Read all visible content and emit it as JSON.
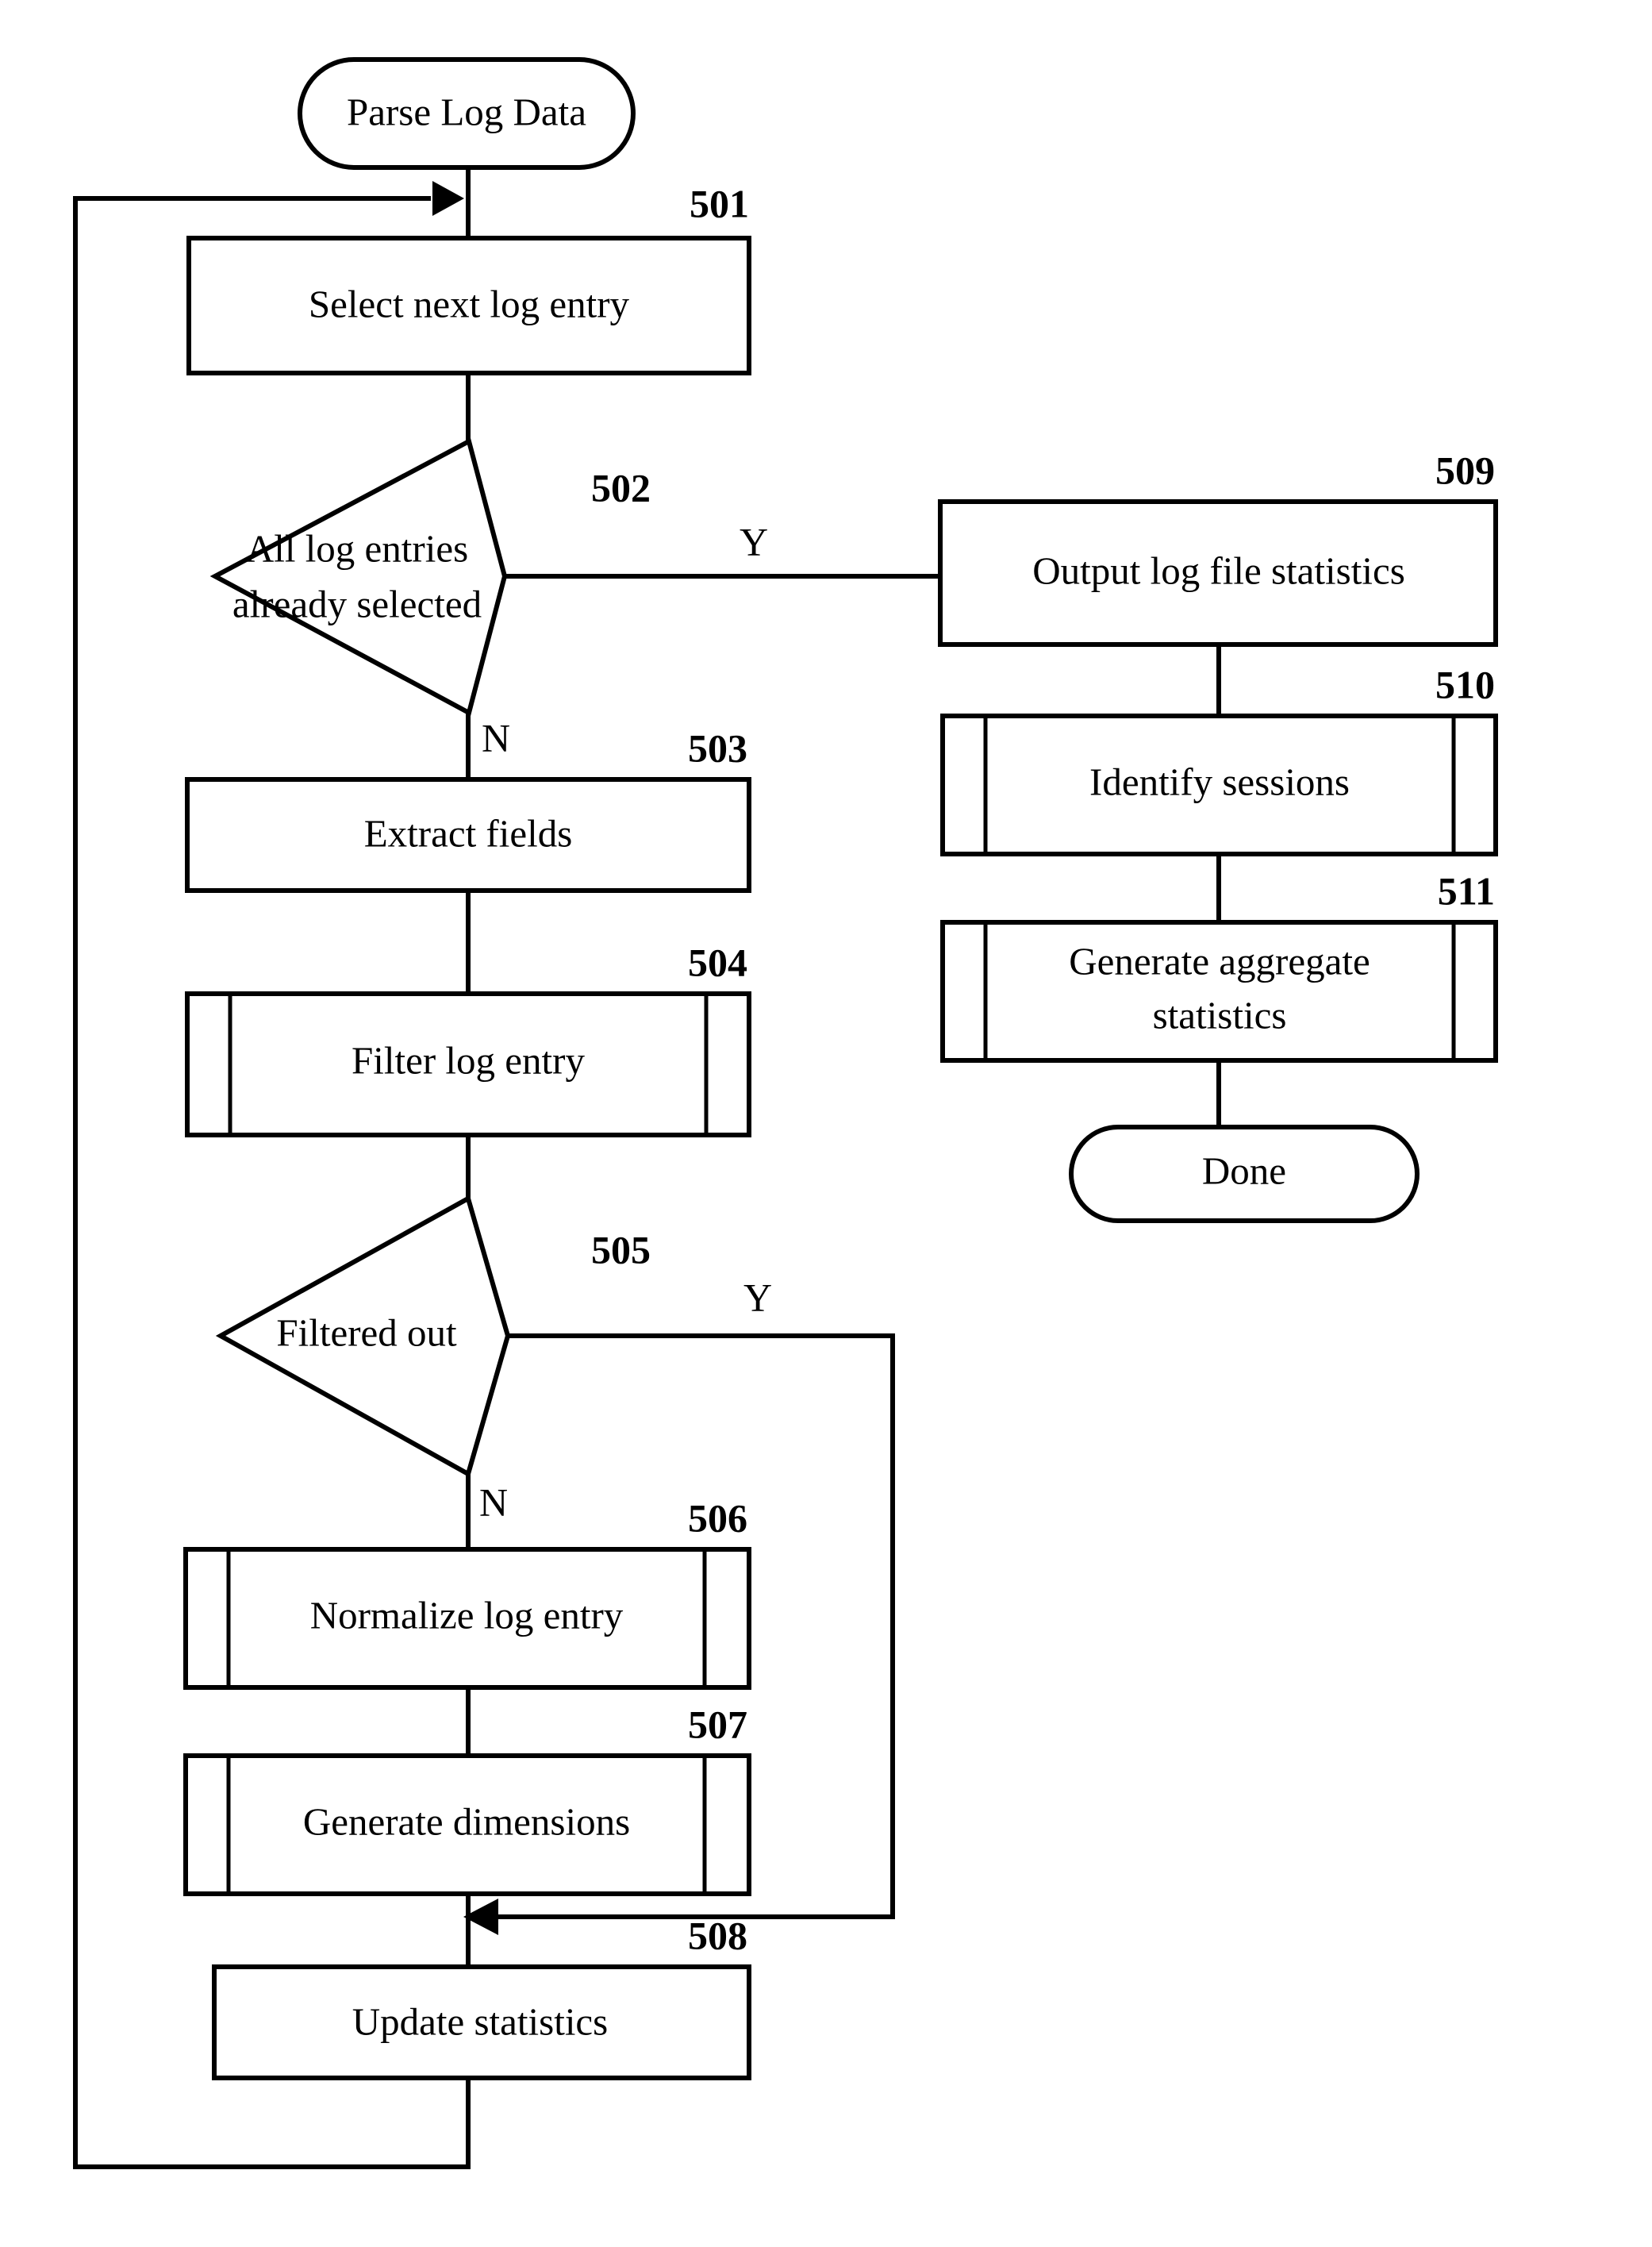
{
  "diagram": {
    "title": "Parse Log Data flowchart",
    "type": "flowchart",
    "colors": {
      "stroke": "#000000",
      "fill": "#ffffff",
      "background": "#ffffff"
    },
    "nodes": {
      "start": {
        "label": "Parse Log Data",
        "shape": "terminator",
        "ref": ""
      },
      "n501": {
        "label": "Select next log entry",
        "shape": "process",
        "ref": "501"
      },
      "n502": {
        "label_line1": "All log entries",
        "label_line2": "already selected",
        "shape": "decision",
        "ref": "502"
      },
      "n503": {
        "label": "Extract fields",
        "shape": "process",
        "ref": "503"
      },
      "n504": {
        "label": "Filter log entry",
        "shape": "predefined-process",
        "ref": "504"
      },
      "n505": {
        "label": "Filtered out",
        "shape": "decision",
        "ref": "505"
      },
      "n506": {
        "label": "Normalize log entry",
        "shape": "predefined-process",
        "ref": "506"
      },
      "n507": {
        "label": "Generate dimensions",
        "shape": "predefined-process",
        "ref": "507"
      },
      "n508": {
        "label": "Update statistics",
        "shape": "process",
        "ref": "508"
      },
      "n509": {
        "label": "Output log file statistics",
        "shape": "process",
        "ref": "509"
      },
      "n510": {
        "label": "Identify sessions",
        "shape": "predefined-process",
        "ref": "510"
      },
      "n511": {
        "label_line1": "Generate aggregate",
        "label_line2": "statistics",
        "shape": "predefined-process",
        "ref": "511"
      },
      "end": {
        "label": "Done",
        "shape": "terminator",
        "ref": ""
      }
    },
    "branch_labels": {
      "d502_yes": "Y",
      "d502_no": "N",
      "d505_yes": "Y",
      "d505_no": "N"
    }
  }
}
